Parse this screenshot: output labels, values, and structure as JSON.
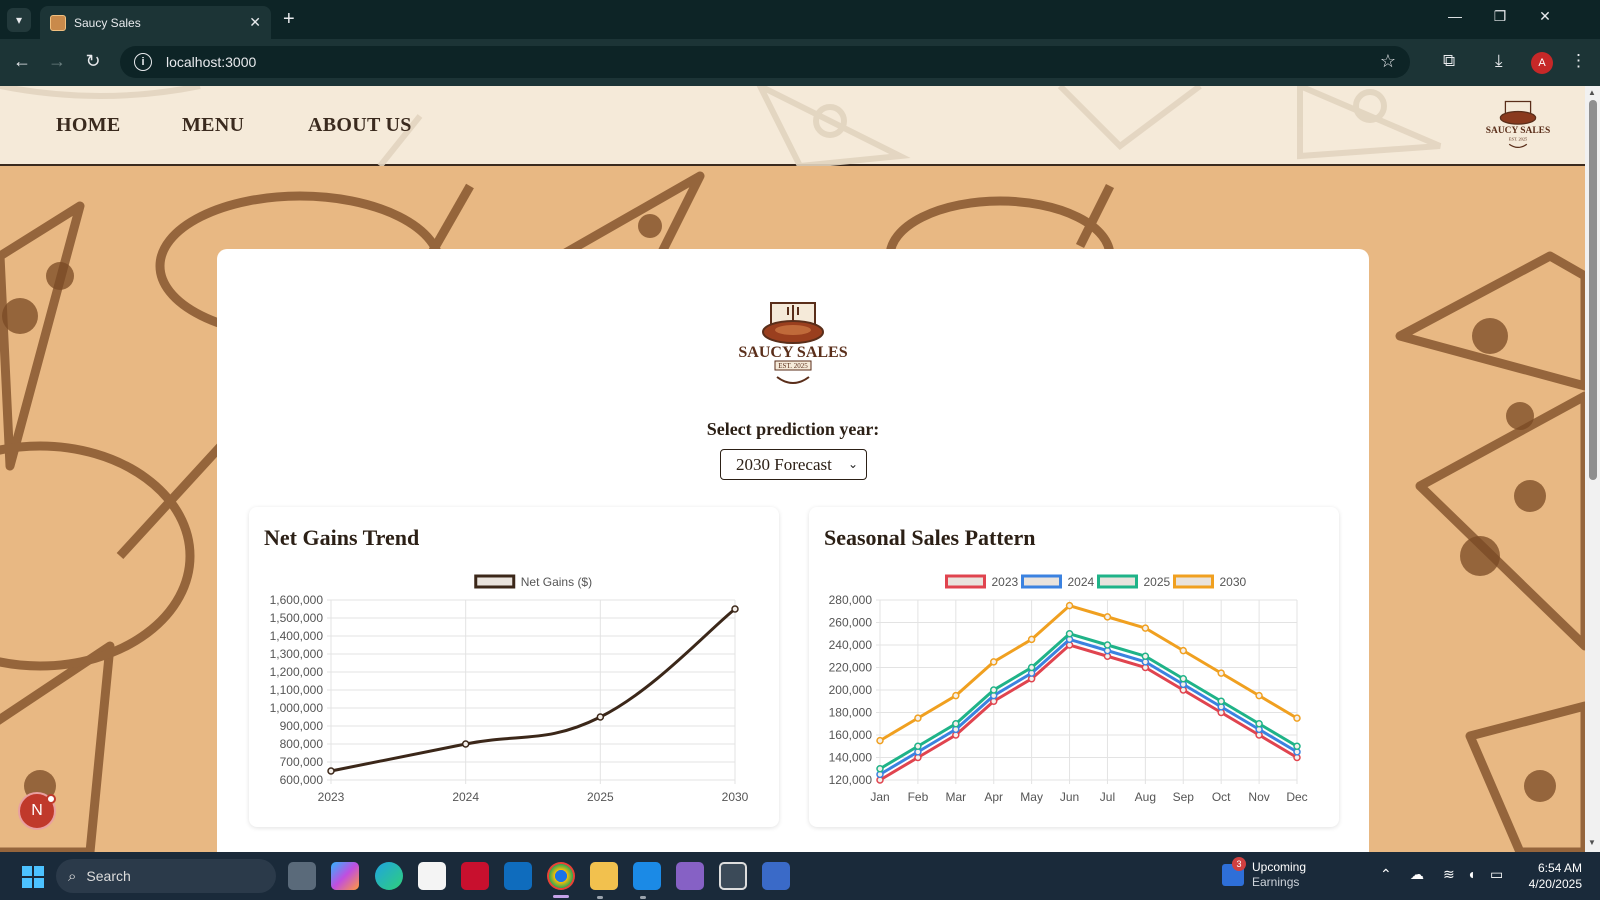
{
  "browser": {
    "tab_title": "Saucy Sales",
    "url": "localhost:3000",
    "profile_initial": "A"
  },
  "site": {
    "nav": [
      "HOME",
      "MENU",
      "ABOUT US"
    ],
    "logo_text": "SAUCY SALES",
    "logo_sub": "EST. 2025"
  },
  "main": {
    "select_label": "Select prediction year:",
    "selected_year": "2030 Forecast"
  },
  "charts": {
    "net_gains_title": "Net Gains Trend",
    "seasonal_title": "Seasonal Sales Pattern"
  },
  "chart_data": [
    {
      "type": "line",
      "categories": [
        "2023",
        "2024",
        "2025",
        "2030"
      ],
      "series": [
        {
          "name": "Net Gains ($)",
          "values": [
            650000,
            800000,
            950000,
            1550000
          ],
          "color": "#3b2719"
        }
      ],
      "ylim": [
        600000,
        1600000
      ],
      "yticks": [
        "1,600,000",
        "1,500,000",
        "1,400,000",
        "1,300,000",
        "1,200,000",
        "1,100,000",
        "1,000,000",
        "900,000",
        "800,000",
        "700,000",
        "600,000"
      ],
      "grid": true,
      "legend": "top"
    },
    {
      "type": "line",
      "categories": [
        "Jan",
        "Feb",
        "Mar",
        "Apr",
        "May",
        "Jun",
        "Jul",
        "Aug",
        "Sep",
        "Oct",
        "Nov",
        "Dec"
      ],
      "series": [
        {
          "name": "2023",
          "values": [
            120000,
            140000,
            160000,
            190000,
            210000,
            240000,
            230000,
            220000,
            200000,
            180000,
            160000,
            140000
          ],
          "color": "#e0444f"
        },
        {
          "name": "2024",
          "values": [
            125000,
            145000,
            165000,
            195000,
            215000,
            245000,
            235000,
            225000,
            205000,
            185000,
            165000,
            145000
          ],
          "color": "#3b82e0"
        },
        {
          "name": "2025",
          "values": [
            130000,
            150000,
            170000,
            200000,
            220000,
            250000,
            240000,
            230000,
            210000,
            190000,
            170000,
            150000
          ],
          "color": "#1fb388"
        },
        {
          "name": "2030",
          "values": [
            155000,
            175000,
            195000,
            225000,
            245000,
            275000,
            265000,
            255000,
            235000,
            215000,
            195000,
            175000
          ],
          "color": "#f0a020"
        }
      ],
      "ylim": [
        120000,
        280000
      ],
      "yticks": [
        "280,000",
        "260,000",
        "240,000",
        "220,000",
        "200,000",
        "180,000",
        "160,000",
        "140,000",
        "120,000"
      ],
      "grid": true,
      "legend": "top"
    }
  ],
  "notification": {
    "initial": "N"
  },
  "taskbar": {
    "search_label": "Search",
    "weather_title": "Upcoming",
    "weather_sub": "Earnings",
    "weather_badge": "3",
    "time": "6:54 AM",
    "date": "4/20/2025"
  }
}
